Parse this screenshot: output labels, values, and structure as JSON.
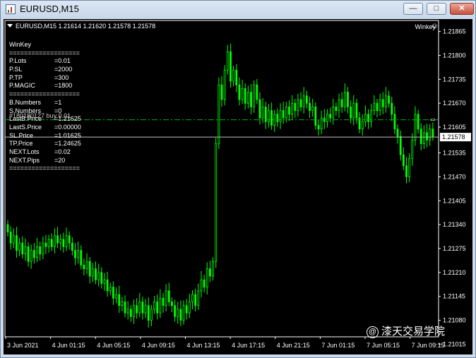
{
  "window": {
    "title": "EURUSD,M15",
    "min_label": "—",
    "max_label": "□",
    "close_label": "✕"
  },
  "chart_header": {
    "symbol_ohlc": "EURUSD,M15  1.21614  1.21620  1.21578  1.21578",
    "ea_name": "Winkey",
    "ea_icon": "smiley-icon"
  },
  "info_panel": {
    "rows": [
      {
        "k": "WinKey",
        "v": ""
      },
      {
        "k": "===================",
        "v": ""
      },
      {
        "k": "P.Lots",
        "v": "=0.01"
      },
      {
        "k": "P.SL",
        "v": "=2000"
      },
      {
        "k": "P.TP",
        "v": "=300"
      },
      {
        "k": "P.MAGIC",
        "v": "=1800"
      },
      {
        "k": "===================",
        "v": ""
      },
      {
        "k": "B.Numbers",
        "v": "=1"
      },
      {
        "k": "S.Numbers",
        "v": "=0"
      },
      {
        "k": "LastB.Price",
        "v": "=1.21625"
      },
      {
        "k": "LastS.Price",
        "v": "=0.00000"
      },
      {
        "k": "SL.Price",
        "v": "=1.01625"
      },
      {
        "k": "TP.Price",
        "v": "=1.24625"
      },
      {
        "k": "NEXT.Lots",
        "v": "=0.02"
      },
      {
        "k": "NEXT.Pips",
        "v": "=20"
      },
      {
        "k": "===================",
        "v": ""
      }
    ]
  },
  "order_label": "#180180127 buy 0.01",
  "colors": {
    "background": "#000000",
    "candle": "#00ff00",
    "text": "#ffffff",
    "order_line": "#00b400",
    "bid_line": "#c0c0c0"
  },
  "chart_data": {
    "type": "candlestick",
    "symbol": "EURUSD",
    "timeframe": "M15",
    "ohlc_last": {
      "open": 1.21614,
      "high": 1.2162,
      "low": 1.21578,
      "close": 1.21578
    },
    "current_price": 1.21578,
    "current_price_label": "1.21578",
    "order_price": 1.21625,
    "ylim": [
      1.21035,
      1.21895
    ],
    "y_ticks": [
      "1.21865",
      "1.21800",
      "1.21735",
      "1.21670",
      "1.21605",
      "1.21535",
      "1.21470",
      "1.21405",
      "1.21340",
      "1.21275",
      "1.21210",
      "1.21145",
      "1.21080",
      "1.21015"
    ],
    "x_ticks": [
      "3 Jun 2021",
      "4 Jun 01:15",
      "4 Jun 05:15",
      "4 Jun 09:15",
      "4 Jun 13:15",
      "4 Jun 17:15",
      "4 Jun 21:15",
      "7 Jun 01:15",
      "7 Jun 05:15",
      "7 Jun 09:15"
    ],
    "closes": [
      1.2132,
      1.2129,
      1.2131,
      1.2127,
      1.2129,
      1.2126,
      1.2128,
      1.2124,
      1.2127,
      1.2125,
      1.2128,
      1.2126,
      1.2129,
      1.2128,
      1.213,
      1.2128,
      1.2131,
      1.2129,
      1.213,
      1.2128,
      1.2131,
      1.2129,
      1.2127,
      1.2125,
      1.2127,
      1.2123,
      1.2122,
      1.2124,
      1.212,
      1.2122,
      1.2119,
      1.2121,
      1.2118,
      1.2119,
      1.2116,
      1.2117,
      1.2114,
      1.2115,
      1.2112,
      1.2113,
      1.211,
      1.2111,
      1.2109,
      1.2112,
      1.211,
      1.2113,
      1.211,
      1.2112,
      1.2108,
      1.2111,
      1.2113,
      1.211,
      1.2114,
      1.2112,
      1.2116,
      1.2113,
      1.2112,
      1.2109,
      1.2111,
      1.2108,
      1.2112,
      1.211,
      1.2113,
      1.2115,
      1.2112,
      1.2116,
      1.2119,
      1.2117,
      1.2122,
      1.212,
      1.2124,
      1.2156,
      1.2172,
      1.2168,
      1.2176,
      1.2181,
      1.2173,
      1.2176,
      1.2172,
      1.2168,
      1.2171,
      1.2167,
      1.217,
      1.2166,
      1.2172,
      1.2168,
      1.2163,
      1.2166,
      1.2162,
      1.2165,
      1.2161,
      1.2164,
      1.2162,
      1.2165,
      1.2163,
      1.2166,
      1.2164,
      1.2167,
      1.2165,
      1.2168,
      1.2166,
      1.2169,
      1.2167,
      1.2165,
      1.2166,
      1.2161,
      1.216,
      1.2163,
      1.2162,
      1.2164,
      1.2163,
      1.2166,
      1.2165,
      1.2168,
      1.2166,
      1.217,
      1.2166,
      1.2163,
      1.2167,
      1.2163,
      1.216,
      1.2162,
      1.2164,
      1.2162,
      1.2165,
      1.2167,
      1.2165,
      1.2168,
      1.2166,
      1.2169,
      1.2167,
      1.2164,
      1.216,
      1.2158,
      1.2153,
      1.215,
      1.2147,
      1.2152,
      1.2157,
      1.2164,
      1.216,
      1.2156,
      1.2159,
      1.2157,
      1.216,
      1.2158
    ]
  },
  "watermark": {
    "icon": "at-icon",
    "text": "@漆天交易学院"
  }
}
